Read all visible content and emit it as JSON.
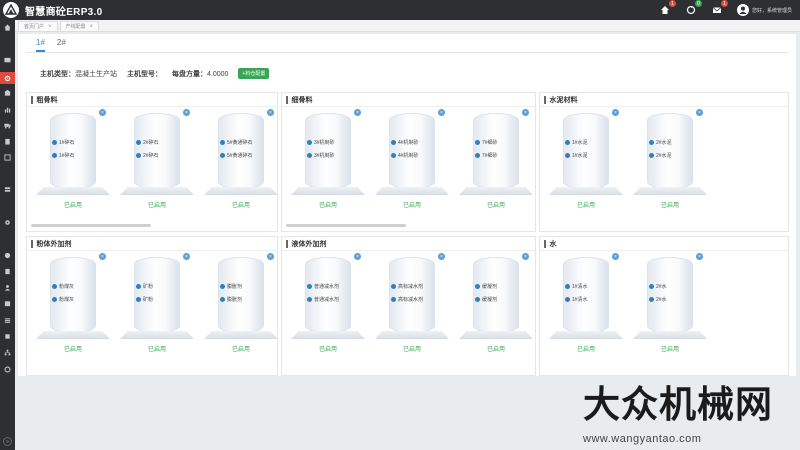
{
  "app": {
    "title": "智慧商砼ERP3.0"
  },
  "topbar": {
    "badges": {
      "home": "1",
      "recycle": "0",
      "mail": "1"
    },
    "user_text": "您好，系统管理员"
  },
  "page_tabs": [
    {
      "label": "首页门户"
    },
    {
      "label": "产线配置"
    }
  ],
  "sub_tabs": [
    "1#",
    "2#"
  ],
  "info": {
    "host_type_label": "主机类型：",
    "host_type_value": "混凝土生产站",
    "host_model_label": "主机型号：",
    "host_model_value": "",
    "tray_label": "每盘方量：",
    "tray_value": "4.0000",
    "mix_button": "+料仓配置"
  },
  "status_enabled": "已启用",
  "cards": [
    {
      "title": "粗骨料",
      "silos": [
        [
          "1#碎石",
          "1#碎石"
        ],
        [
          "2#碎石",
          "2#碎石"
        ],
        [
          "5#黄通碎石",
          "5#黄通碎石"
        ]
      ]
    },
    {
      "title": "细骨料",
      "silos": [
        [
          "3#机制砂",
          "3#机制砂"
        ],
        [
          "4#机制砂",
          "4#机制砂"
        ],
        [
          "7#细砂",
          "7#细砂"
        ]
      ]
    },
    {
      "title": "水泥材料",
      "silos": [
        [
          "1#水泥",
          "1#水泥"
        ],
        [
          "2#水泥",
          "2#水泥"
        ]
      ]
    },
    {
      "title": "粉体外加剂",
      "silos": [
        [
          "粉煤灰",
          "粉煤灰"
        ],
        [
          "矿粉",
          "矿粉"
        ],
        [
          "膨胀剂",
          "膨胀剂"
        ]
      ]
    },
    {
      "title": "液体外加剂",
      "silos": [
        [
          "普通减水剂",
          "普通减水剂"
        ],
        [
          "高标减水剂",
          "高标减水剂"
        ],
        [
          "缓凝剂",
          "缓凝剂"
        ]
      ]
    },
    {
      "title": "水",
      "silos": [
        [
          "1#清水",
          "1#清水"
        ],
        [
          "2#水",
          "2#水"
        ]
      ]
    }
  ],
  "watermark": {
    "main": "大众机械网",
    "url": "www.wangyantao.com"
  },
  "colors": {
    "accent": "#2a8bd5",
    "enabled": "#3aa655",
    "sidebar": "#2d2f33",
    "active_menu": "#e04a3a"
  }
}
